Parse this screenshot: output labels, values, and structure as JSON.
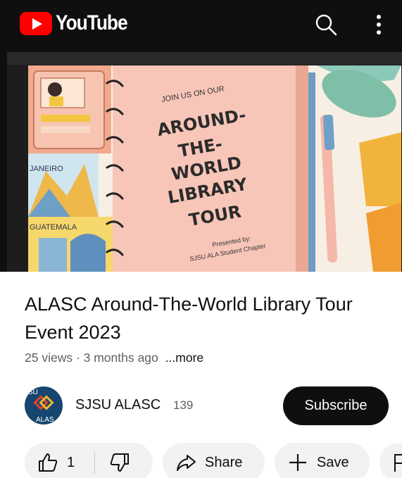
{
  "app": {
    "name": "YouTube"
  },
  "topbar": {
    "search_icon": "search-icon",
    "more_icon": "more-vert-icon"
  },
  "player": {
    "slide": {
      "heading_small": "JOIN US ON OUR",
      "title_lines": [
        "AROUND-",
        "THE-",
        "WORLD",
        "LIBRARY",
        "TOUR"
      ],
      "presented_by": "Presented by:",
      "presenter": "SJSU ALA Student Chapter",
      "stamp_labels": [
        "JANEIRO",
        "GUATEMALA"
      ]
    }
  },
  "video": {
    "title": "ALASC Around-The-World Library Tour Event 2023",
    "meta": "25 views · 3 months ago",
    "more_label": "...more"
  },
  "channel": {
    "name": "SJSU ALASC",
    "subscriber_count": "139",
    "subscribe_label": "Subscribe",
    "avatar_text_top": "SU",
    "avatar_text_bottom": "ALAS"
  },
  "actions": {
    "like_count": "1",
    "share_label": "Share",
    "save_label": "Save"
  },
  "colors": {
    "brand_red": "#ff0000",
    "bar_bg": "#0f0f0f",
    "chip_bg": "#f2f2f2",
    "secondary_text": "#606060"
  }
}
